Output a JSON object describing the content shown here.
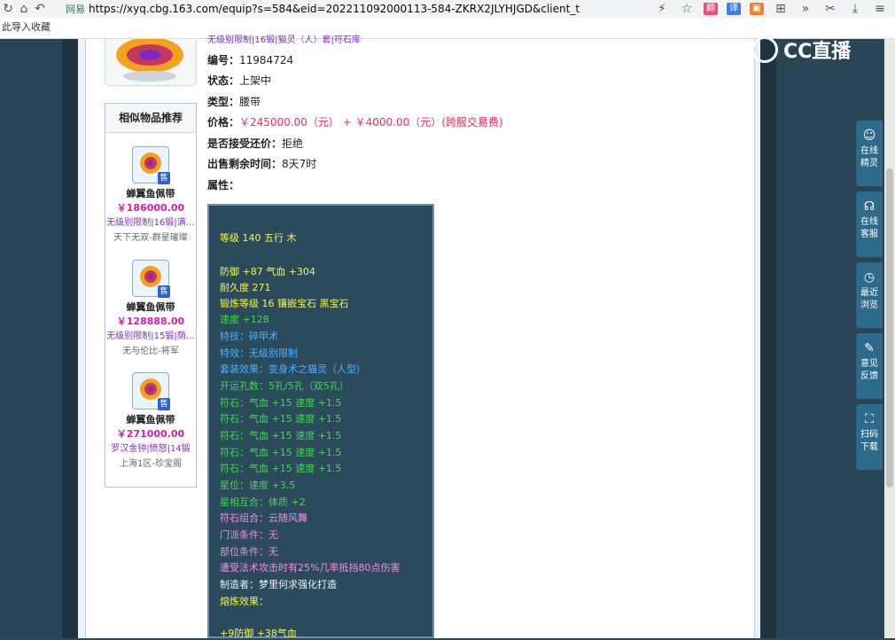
{
  "browser": {
    "url": "https://xyq.cbg.163.com/equip?s=584&eid=202211092000113-584-ZKRX2JLYHJGD&client_t",
    "secure_label": "网易",
    "bookmark_hint": "此导入收藏",
    "ext_translate": "译",
    "ext_b": "翻"
  },
  "watermark": {
    "text": "CC直播"
  },
  "info": {
    "top_partial": "无级别限制|16锻|猫灵（人）套|符石库",
    "id_label": "编号：",
    "id_value": "11984724",
    "status_label": "状态：",
    "status_value": "上架中",
    "type_label": "类型：",
    "type_value": "腰带",
    "price_label": "价格：",
    "price_value": "￥245000.00（元）  +  ￥4000.00（元）(跨服交易费)",
    "bargain_label": "是否接受还价：",
    "bargain_value": "拒绝",
    "time_label": "出售剩余时间：",
    "time_value": "8天7时",
    "attr_label": "属性："
  },
  "recommend": {
    "title": "相似物品推荐",
    "items": [
      {
        "name": "蝉翼鱼佩带",
        "price": "￥186000.00",
        "tags": "无级别限制|16锻|满…",
        "server": "天下无双-群星璀璨",
        "badge": "售"
      },
      {
        "name": "蝉翼鱼佩带",
        "price": "￥128888.00",
        "tags": "无级别限制|15锻|荫…",
        "server": "无与伦比-将军",
        "badge": "售"
      },
      {
        "name": "蝉翼鱼佩带",
        "price": "￥271000.00",
        "tags": "罗汉金钟|愤怒|14锻",
        "server": "上海1区-珍宝阁",
        "badge": "售"
      }
    ]
  },
  "attributes": [
    {
      "text": "等级 140 五行 木",
      "color": "yellow"
    },
    {
      "text": "防御 +87 气血 +304",
      "color": "yellow"
    },
    {
      "text": "耐久度 271",
      "color": "yellow"
    },
    {
      "text": "锻炼等级 16 镶嵌宝石 黑宝石",
      "color": "yellow"
    },
    {
      "text": "速度 +128",
      "color": "green"
    },
    {
      "text": "特技：碎甲术",
      "color": "blue"
    },
    {
      "text": "特效：无级别限制",
      "color": "blue"
    },
    {
      "text": "套装效果：变身术之猫灵（人型）",
      "color": "blue"
    },
    {
      "text": "开运孔数：5孔/5孔（双5孔）",
      "color": "green"
    },
    {
      "text": "符石：气血 +15 速度 +1.5",
      "color": "green"
    },
    {
      "text": "符石：气血 +15 速度 +1.5",
      "color": "green"
    },
    {
      "text": "符石：气血 +15 速度 +1.5",
      "color": "green"
    },
    {
      "text": "符石：气血 +15 速度 +1.5",
      "color": "green"
    },
    {
      "text": "符石：气血 +15 速度 +1.5",
      "color": "green"
    },
    {
      "text": "星位：速度 +3.5",
      "color": "green"
    },
    {
      "text": "星相互合：体质 +2",
      "color": "green"
    },
    {
      "text": "符石组合：云随风舞",
      "color": "pink"
    },
    {
      "text": "门派条件：无",
      "color": "pink"
    },
    {
      "text": "部位条件：无",
      "color": "pink"
    },
    {
      "text": "遭受法术攻击时有25%几率抵挡80点伤害",
      "color": "pink"
    },
    {
      "text": "制造者：梦里何求强化打造",
      "color": "white"
    },
    {
      "text": "熔炼效果：",
      "color": "yellow"
    },
    {
      "text": "+9防御 +38气血",
      "color": "yellow"
    }
  ],
  "sidebar": [
    {
      "label1": "在线",
      "label2": "精灵",
      "icon": "☺"
    },
    {
      "label1": "在线",
      "label2": "客服",
      "icon": "☊"
    },
    {
      "label1": "最近",
      "label2": "浏览",
      "icon": "◷"
    },
    {
      "label1": "意见",
      "label2": "反馈",
      "icon": "✎"
    },
    {
      "label1": "扫码",
      "label2": "下载",
      "icon": "⛶"
    }
  ],
  "colors": {
    "yellow": "#f6f64a",
    "green": "#3cd84e",
    "blue": "#4ab0ff",
    "pink": "#f08be8",
    "white": "#f2f2f2"
  }
}
